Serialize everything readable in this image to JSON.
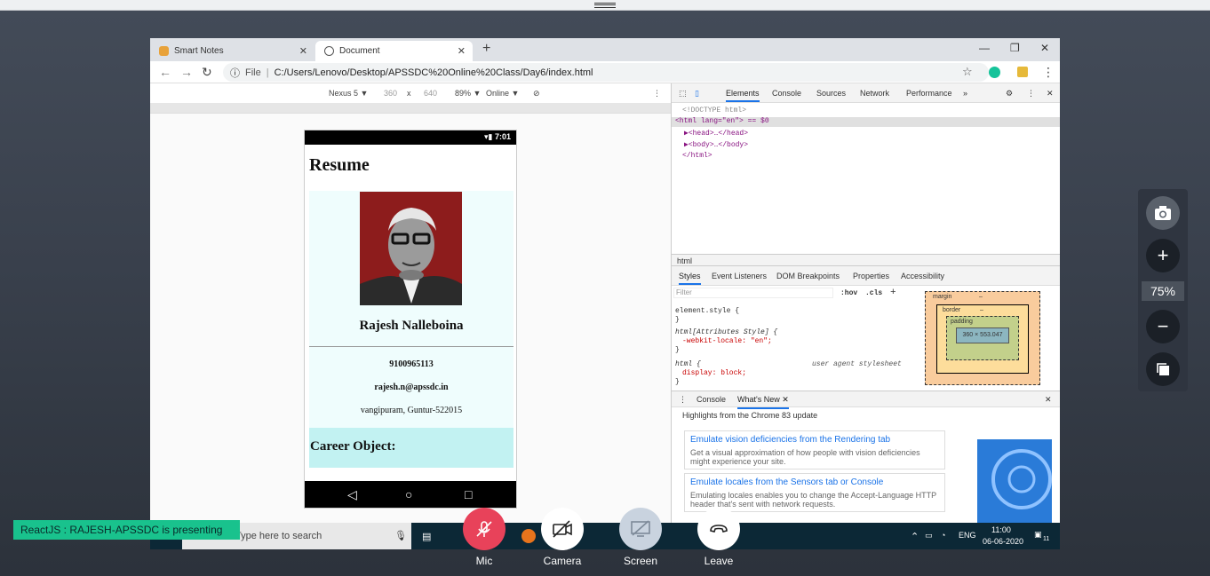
{
  "browser": {
    "tabs": [
      {
        "label": "Smart Notes",
        "icon": "notes-icon"
      },
      {
        "label": "Document",
        "icon": "globe-icon"
      }
    ],
    "address": {
      "scheme_label": "File",
      "url": "C:/Users/Lenovo/Desktop/APSSDC%20Online%20Class/Day6/index.html"
    }
  },
  "device_toolbar": {
    "device": "Nexus 5 ▼",
    "width": "360",
    "times": "x",
    "height": "640",
    "zoom": "89% ▼",
    "network": "Online ▼"
  },
  "phone": {
    "time": "7:01",
    "title": "Resume",
    "name": "Rajesh Nalleboina",
    "phone_number": "9100965113",
    "email": "rajesh.n@apssdc.in",
    "address": "vangipuram, Guntur-522015",
    "section_heading": "Career Object:"
  },
  "devtools": {
    "tabs": [
      "Elements",
      "Console",
      "Sources",
      "Network",
      "Performance",
      "»"
    ],
    "dom": {
      "doctype": "<!DOCTYPE html>",
      "html_open": "<html lang=\"en\"> == $0",
      "head": "▶<head>…</head>",
      "body": "▶<body>…</body>",
      "html_close": "</html>"
    },
    "breadcrumb": "html",
    "style_tabs": [
      "Styles",
      "Event Listeners",
      "DOM Breakpoints",
      "Properties",
      "Accessibility"
    ],
    "filter_placeholder": "Filter",
    "hov": ":hov",
    "cls": ".cls",
    "rules": {
      "r1": "element.style {",
      "r1_close": "}",
      "r2": "html[Attributes Style] {",
      "r2_prop": "-webkit-locale: \"en\";",
      "r2_close": "}",
      "r3": "html {",
      "r3_src": "user agent stylesheet",
      "r3_prop": "display: block;",
      "r3_close": "}"
    },
    "box_model": {
      "margin": "margin",
      "border": "border",
      "padding": "padding",
      "content": "360 × 553.047",
      "dash": "–"
    },
    "drawer": {
      "tabs": [
        "Console",
        "What's New ✕"
      ],
      "highlights": "Highlights from the Chrome 83 update",
      "items": [
        {
          "title": "Emulate vision deficiencies from the Rendering tab",
          "desc": "Get a visual approximation of how people with vision deficiencies might experience your site."
        },
        {
          "title": "Emulate locales from the Sensors tab or Console",
          "desc": "Emulating locales enables you to change the Accept-Language HTTP header that's sent with network requests."
        }
      ]
    }
  },
  "taskbar": {
    "search": "Type here to search",
    "lang": "ENG",
    "time": "11:00",
    "date": "06-06-2020",
    "notif_count": "11"
  },
  "meeting": {
    "presenting": "ReactJS : RAJESH-APSSDC is presenting",
    "controls": [
      {
        "label": "Mic",
        "icon": "mic-off-icon",
        "color": "#e8425a"
      },
      {
        "label": "Camera",
        "icon": "camera-off-icon",
        "color": "#ffffff"
      },
      {
        "label": "Screen",
        "icon": "screen-share-icon",
        "color": "#c9d3df"
      },
      {
        "label": "Leave",
        "icon": "hang-up-icon",
        "color": "#ffffff"
      }
    ],
    "zoom_level": "75%"
  }
}
